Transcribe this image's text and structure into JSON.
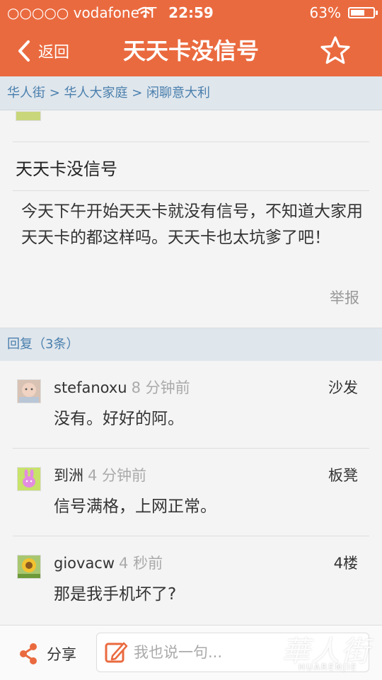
{
  "status_bar": {
    "carrier": "○○○○○ vodafone IT",
    "time": "22:59",
    "battery": "63%",
    "battery_level": 0.63
  },
  "navbar": {
    "back_label": "返回",
    "title": "天天卡没信号",
    "back_icon": "chevron-left-icon",
    "favorite_icon": "star-icon"
  },
  "breadcrumb": "华人街 > 华人大家庭 > 闲聊意大利",
  "post": {
    "title": "天天卡没信号",
    "body": "今天下午开始天天卡就没有信号，不知道大家用天天卡的都这样吗。天天卡也太坑爹了吧！",
    "report_label": "举报"
  },
  "replies_header": "回复（3条）",
  "replies": [
    {
      "user": "stefanoxu",
      "time": "8 分钟前",
      "floor": "沙发",
      "content": "没有。好好的阿。"
    },
    {
      "user": "到洲",
      "time": "4 分钟前",
      "floor": "板凳",
      "content": "信号满格，上网正常。"
    },
    {
      "user": "giovacw",
      "time": "4 秒前",
      "floor": "4楼",
      "content": "那是我手机坏了?"
    }
  ],
  "bottom_bar": {
    "share_label": "分享",
    "comment_placeholder": "我也说一句...",
    "share_icon": "share-icon",
    "edit_icon": "edit-icon"
  },
  "watermark": {
    "cn": "華人街",
    "en": "HUARENJIE"
  },
  "colors": {
    "accent": "#ea6a3f",
    "link": "#4a7fad",
    "section_bg": "#dfe6ec"
  }
}
